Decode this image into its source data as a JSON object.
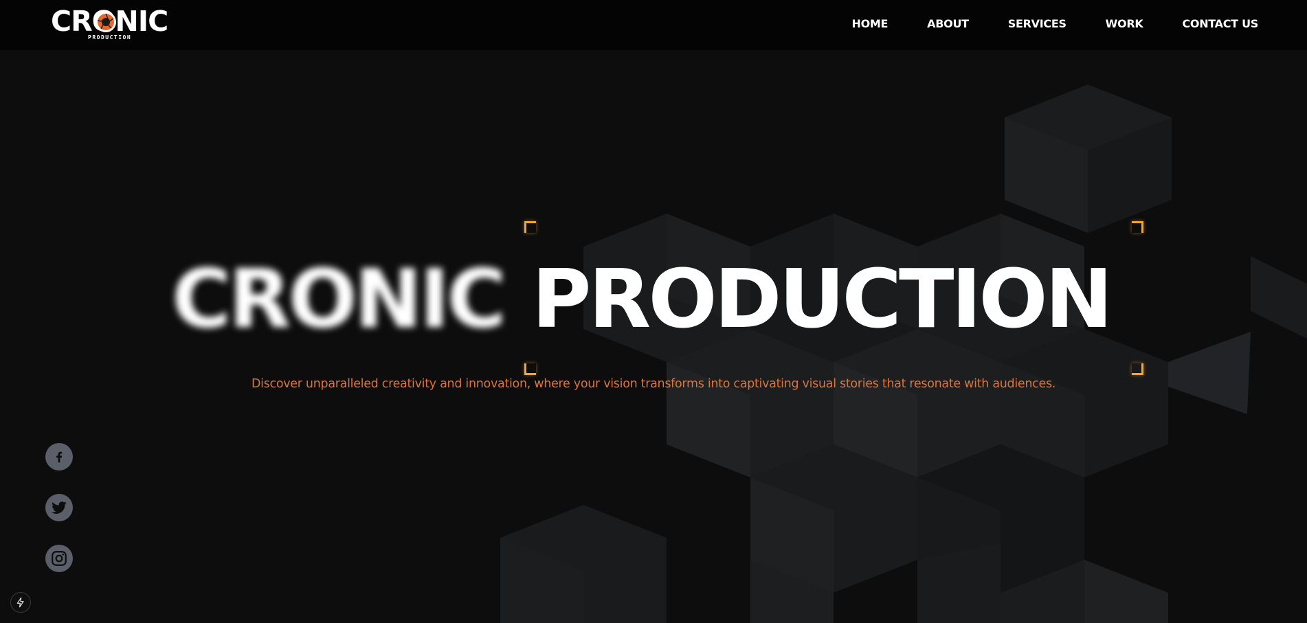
{
  "header": {
    "logo_word": "CRONIC",
    "logo_sub": "PRODUCTION",
    "nav": [
      {
        "label": "HOME"
      },
      {
        "label": "ABOUT"
      },
      {
        "label": "SERVICES"
      },
      {
        "label": "WORK"
      },
      {
        "label": "CONTACT US"
      }
    ]
  },
  "hero": {
    "title_blurred": "CRONIC",
    "title_sharp": "PRODUCTION",
    "tagline": "Discover unparalleled creativity and innovation, where your vision transforms into captivating visual stories that resonate with audiences."
  },
  "social": [
    {
      "icon": "facebook-icon"
    },
    {
      "icon": "twitter-icon"
    },
    {
      "icon": "instagram-icon"
    }
  ],
  "floating": {
    "icon": "bolt-icon"
  },
  "colors": {
    "accent": "#f7a530",
    "tagline": "#d9753e",
    "background": "#0d0d0d",
    "header": "#040404",
    "social_bg": "#5a5f69"
  }
}
